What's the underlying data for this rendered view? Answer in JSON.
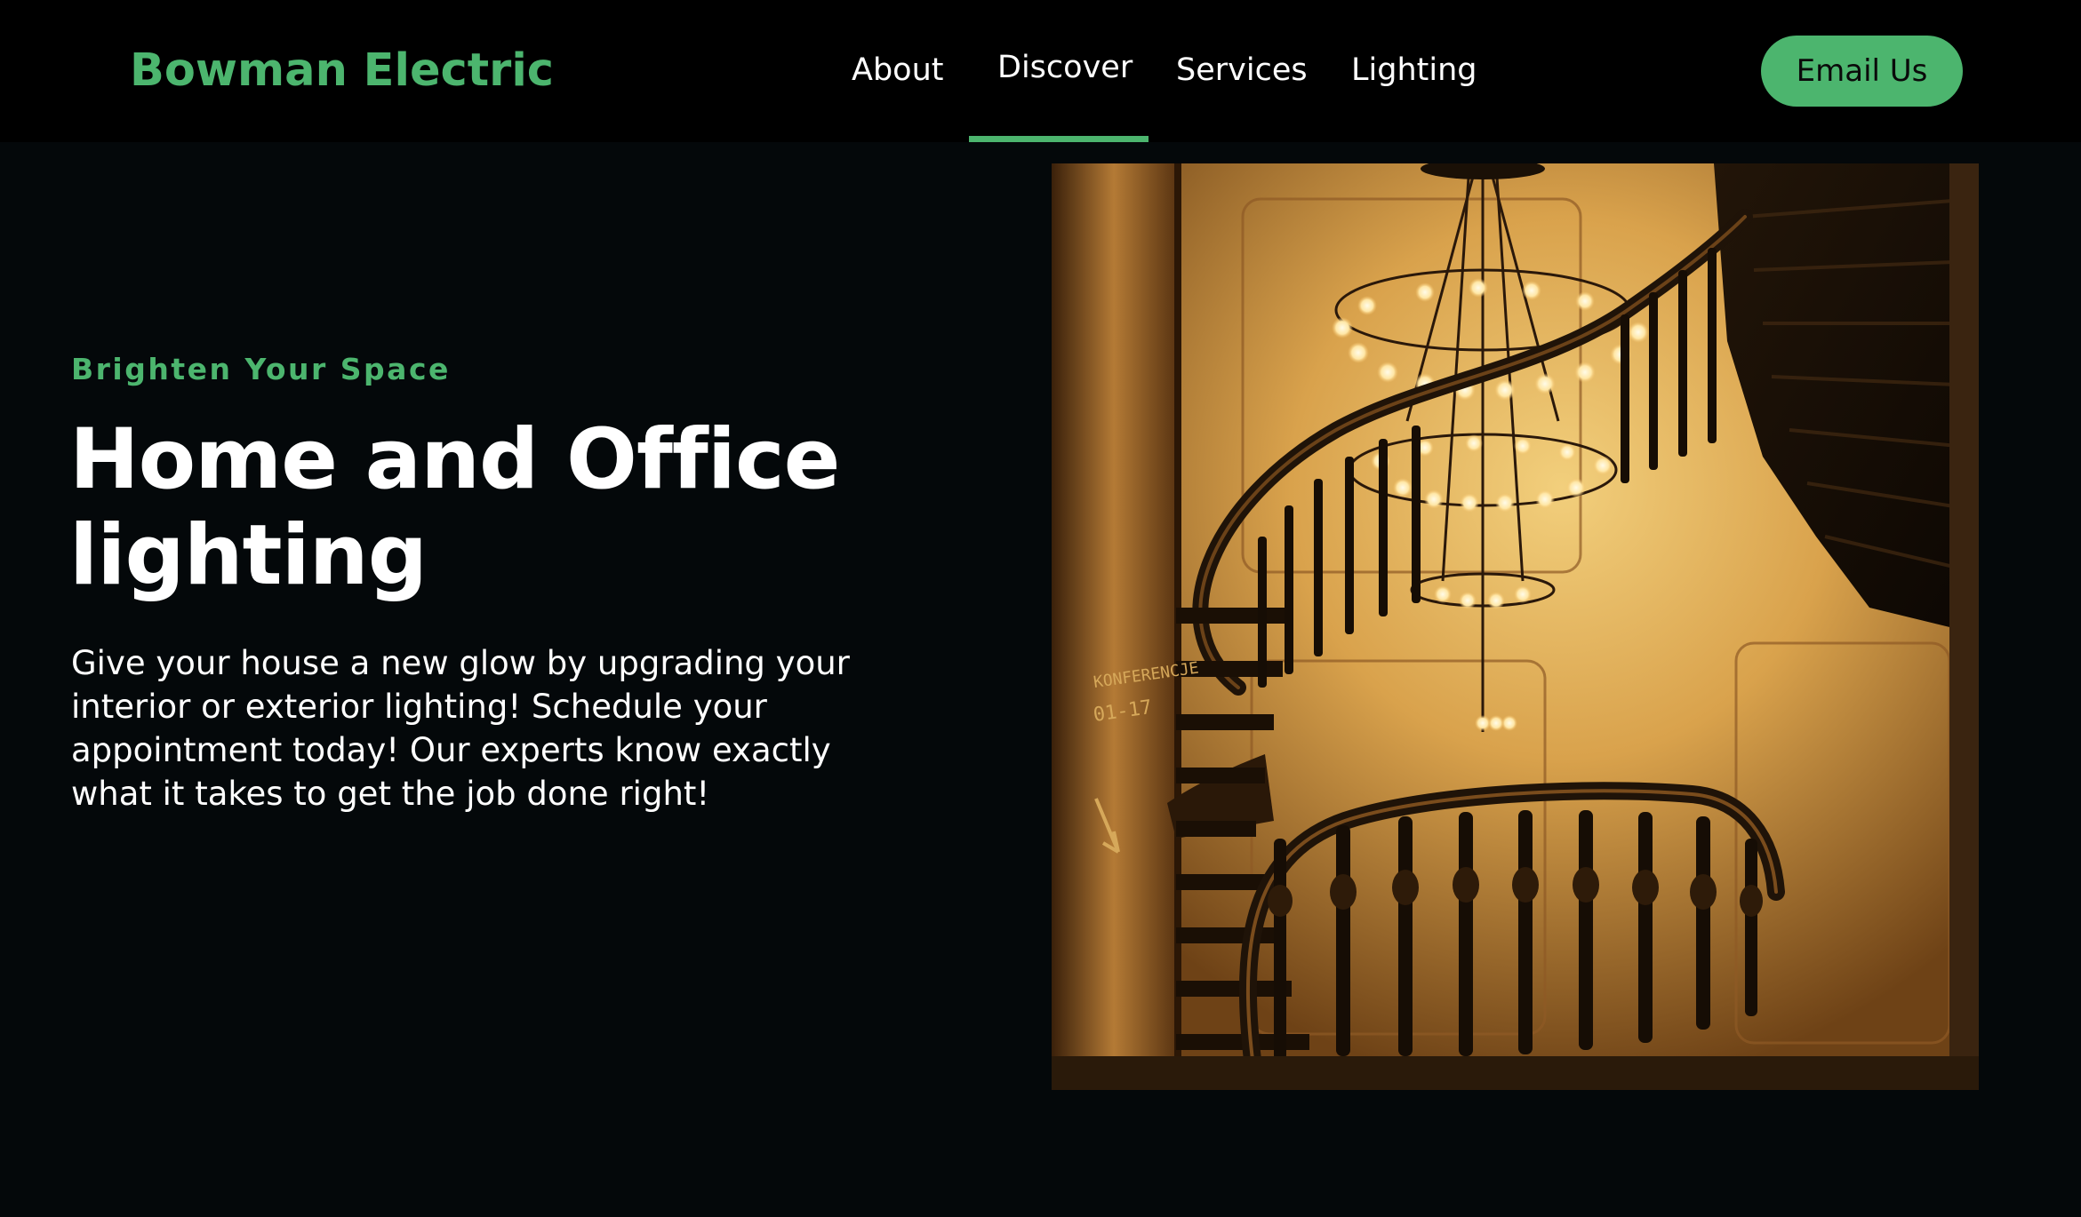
{
  "header": {
    "brand": "Bowman Electric",
    "nav": {
      "about": "About",
      "discover": "Discover",
      "services": "Services",
      "lighting": "Lighting"
    },
    "active_nav": "Discover",
    "cta_label": "Email Us"
  },
  "hero": {
    "eyebrow": "Brighten Your Space",
    "title": "Home and Office lighting",
    "body": "Give your house a new glow by upgrading your interior or exterior lighting! Schedule your appointment today! Our experts know exactly what it takes to get the job done right!",
    "image": {
      "sign_line1": "KONFERENCJE",
      "sign_line2": "01-17"
    }
  },
  "colors": {
    "accent": "#4cb56e",
    "background": "#04080a",
    "nav_background": "#000000",
    "text": "#ffffff"
  }
}
